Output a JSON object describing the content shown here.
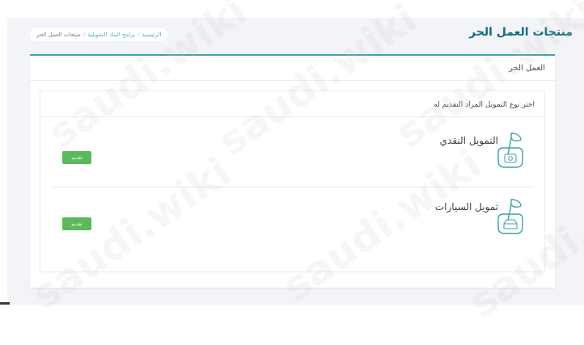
{
  "header": {
    "page_title": "منتجات العمل الحر"
  },
  "breadcrumb": {
    "items": [
      "الرئيسية",
      "برامج البنك التمويلية",
      "منتجات العمل الحر"
    ],
    "separator": "/"
  },
  "card": {
    "title": "العمل الحر"
  },
  "panel": {
    "header": "اختر نوع التمويل المراد التقديم له"
  },
  "products": [
    {
      "name": "التمويل النقدي",
      "button_label": "تقديم",
      "icon": "cash-financing-icon"
    },
    {
      "name": "تمويل السيارات",
      "button_label": "تقديم",
      "icon": "car-financing-icon"
    }
  ],
  "watermark": {
    "text": "saudi.wiki"
  },
  "colors": {
    "accent": "#3ea3a6",
    "title": "#0f6d7f",
    "button": "#5cb85c",
    "background": "#f3f4f8"
  }
}
